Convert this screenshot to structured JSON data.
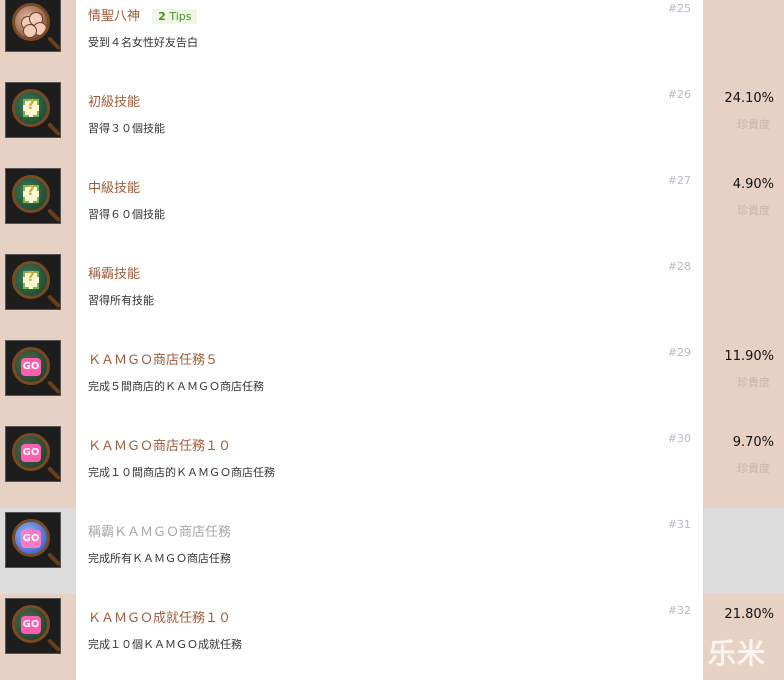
{
  "achievements": [
    {
      "icon": "people-icon",
      "title": "情聖八神",
      "tips": {
        "count": "2",
        "label": "Tips"
      },
      "desc": "受到４名女性好友告白",
      "num": "#25",
      "pct": "",
      "rarity": "",
      "locked": false
    },
    {
      "icon": "skill-icon",
      "title": "初級技能",
      "desc": "習得３０個技能",
      "num": "#26",
      "pct": "24.10%",
      "rarity": "珍貴度",
      "locked": false
    },
    {
      "icon": "skill-icon",
      "title": "中級技能",
      "desc": "習得６０個技能",
      "num": "#27",
      "pct": "4.90%",
      "rarity": "珍貴度",
      "locked": false
    },
    {
      "icon": "skill-icon",
      "title": "稱霸技能",
      "desc": "習得所有技能",
      "num": "#28",
      "pct": "",
      "rarity": "",
      "locked": false
    },
    {
      "icon": "kamgo-icon",
      "title": "ＫＡＭＧＯ商店任務５",
      "desc": "完成５間商店的ＫＡＭＧＯ商店任務",
      "num": "#29",
      "pct": "11.90%",
      "rarity": "珍貴度",
      "locked": false
    },
    {
      "icon": "kamgo-icon",
      "title": "ＫＡＭＧＯ商店任務１０",
      "desc": "完成１０間商店的ＫＡＭＧＯ商店任務",
      "num": "#30",
      "pct": "9.70%",
      "rarity": "珍貴度",
      "locked": false
    },
    {
      "icon": "kamgo-blue-icon",
      "title": "稱霸ＫＡＭＧＯ商店任務",
      "desc": "完成所有ＫＡＭＧＯ商店任務",
      "num": "#31",
      "pct": "",
      "rarity": "",
      "locked": true
    },
    {
      "icon": "kamgo-icon",
      "title": "ＫＡＭＧＯ成就任務１０",
      "desc": "完成１０個ＫＡＭＧＯ成就任務",
      "num": "#32",
      "pct": "21.80%",
      "rarity": "",
      "locked": false
    }
  ],
  "badge_text": "GO",
  "watermark": "乐米",
  "colors": {
    "side_panel": "#e7d1c4",
    "side_panel_locked": "#dcdcdc",
    "title": "#a15b3a",
    "title_locked": "#a7a7a7",
    "number": "#b9b9c7",
    "tips_bg": "#eef7e3",
    "tips_text": "#4b8f2b"
  }
}
